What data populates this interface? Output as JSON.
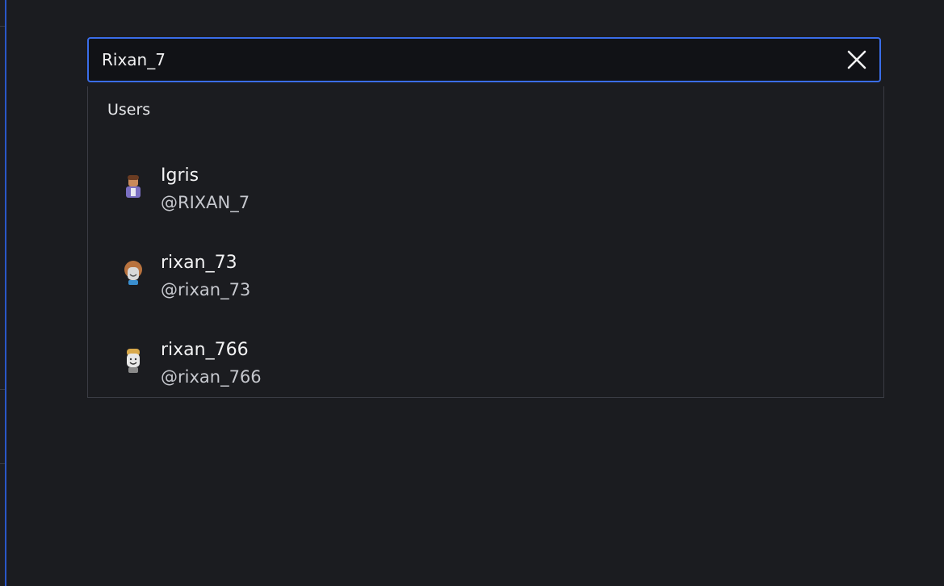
{
  "search": {
    "value": "Rixan_7",
    "clear_icon": "close-icon"
  },
  "dropdown": {
    "section_label": "Users",
    "users": [
      {
        "display_name": "Igris",
        "username": "@RIXAN_7",
        "avatar_icon": "avatar-icon"
      },
      {
        "display_name": "rixan_73",
        "username": "@rixan_73",
        "avatar_icon": "avatar-icon"
      },
      {
        "display_name": "rixan_766",
        "username": "@rixan_766",
        "avatar_icon": "avatar-icon"
      }
    ]
  },
  "colors": {
    "background": "#1b1c20",
    "focus_border": "#3a6de8",
    "input_background": "#111216"
  }
}
